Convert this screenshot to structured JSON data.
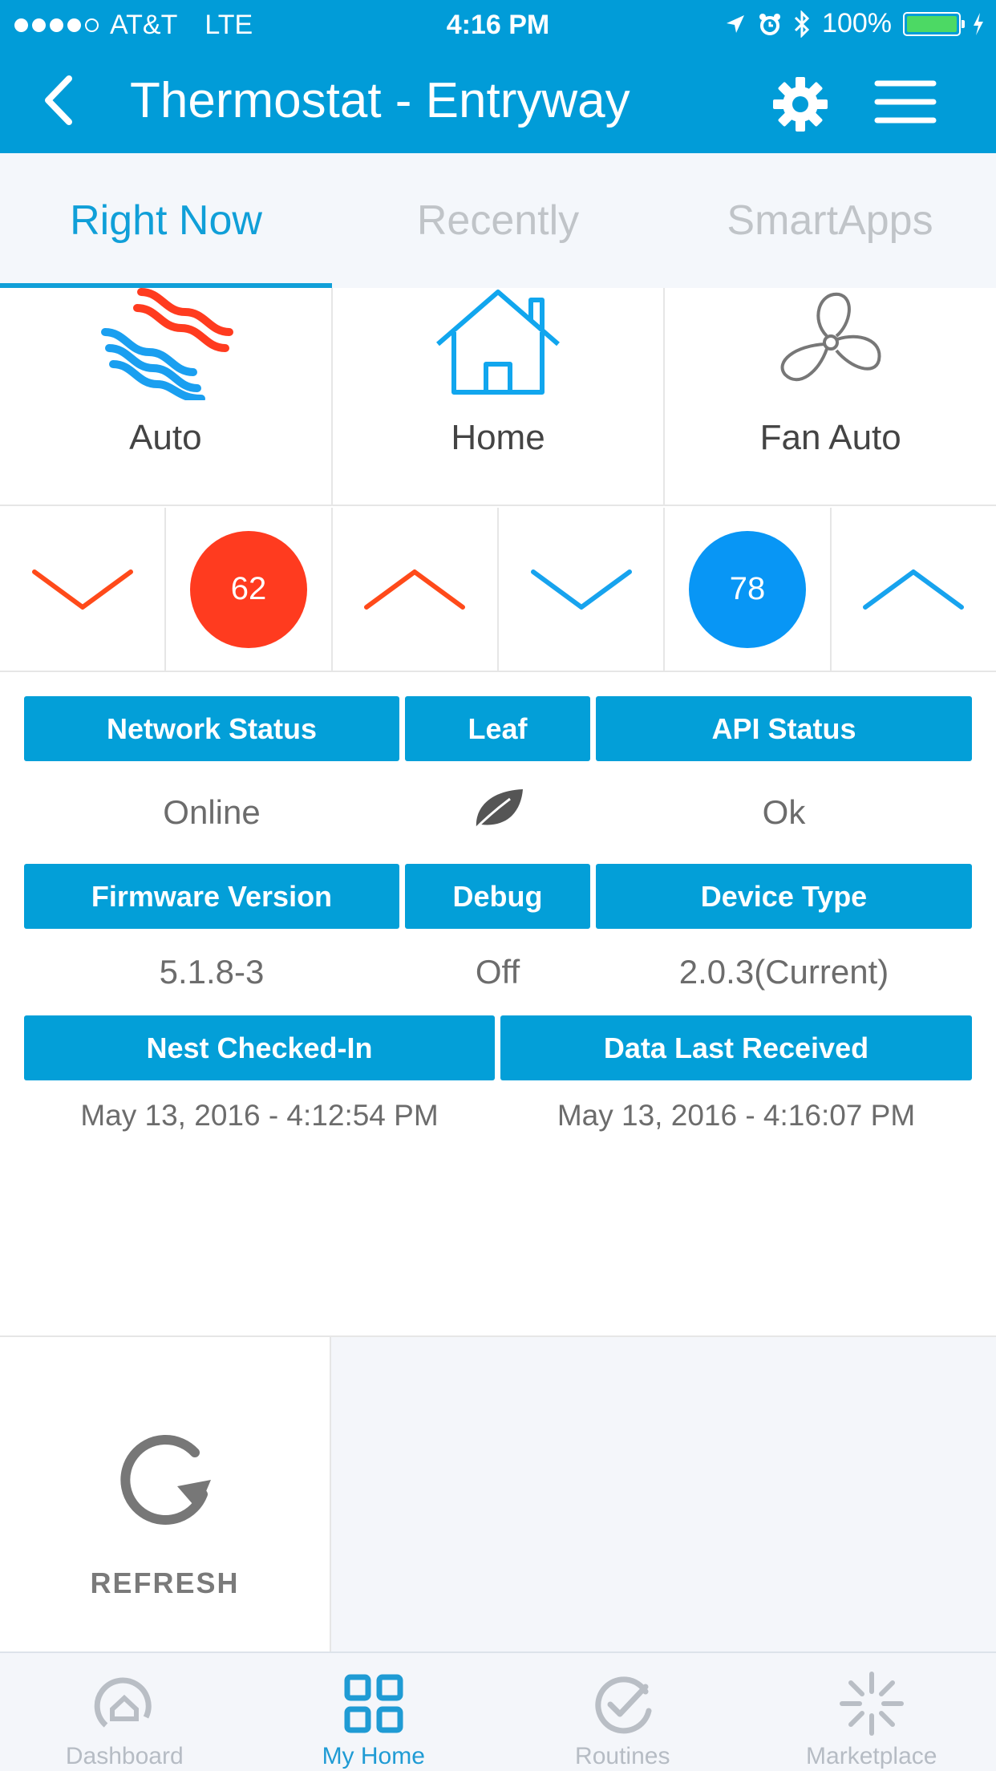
{
  "status_bar": {
    "carrier": "AT&T",
    "network": "LTE",
    "time": "4:16 PM",
    "battery": "100%",
    "signal_bars": 4
  },
  "header": {
    "title": "Thermostat - Entryway",
    "icons": [
      "back-chevron-icon",
      "gear-icon",
      "hamburger-menu-icon"
    ]
  },
  "tabs": [
    {
      "label": "Right Now",
      "active": true
    },
    {
      "label": "Recently",
      "active": false
    },
    {
      "label": "SmartApps",
      "active": false
    }
  ],
  "modes": [
    {
      "label": "Auto",
      "icon": "heat-cool-waves-icon"
    },
    {
      "label": "Home",
      "icon": "house-icon"
    },
    {
      "label": "Fan Auto",
      "icon": "fan-icon"
    }
  ],
  "setpoints": {
    "heat": "62",
    "cool": "78",
    "colors": {
      "heat": "#ff3b1f",
      "cool": "#0896f5"
    }
  },
  "info": {
    "network_status": {
      "label": "Network Status",
      "value": "Online"
    },
    "leaf": {
      "label": "Leaf",
      "icon": "leaf-icon"
    },
    "api_status": {
      "label": "API Status",
      "value": "Ok"
    },
    "firmware_version": {
      "label": "Firmware Version",
      "value": "5.1.8-3"
    },
    "debug": {
      "label": "Debug",
      "value": "Off"
    },
    "device_type": {
      "label": "Device Type",
      "value": "2.0.3(Current)"
    },
    "nest_checked_in": {
      "label": "Nest Checked-In",
      "value": "May 13, 2016 - 4:12:54 PM"
    },
    "data_last_received": {
      "label": "Data Last Received",
      "value": "May 13, 2016 - 4:16:07 PM"
    }
  },
  "refresh": {
    "label": "REFRESH"
  },
  "bottom_nav": [
    {
      "label": "Dashboard",
      "active": false
    },
    {
      "label": "My Home",
      "active": true
    },
    {
      "label": "Routines",
      "active": false
    },
    {
      "label": "Marketplace",
      "active": false
    }
  ],
  "colors": {
    "accent": "#019cd8",
    "tab_active": "#109fd8"
  }
}
